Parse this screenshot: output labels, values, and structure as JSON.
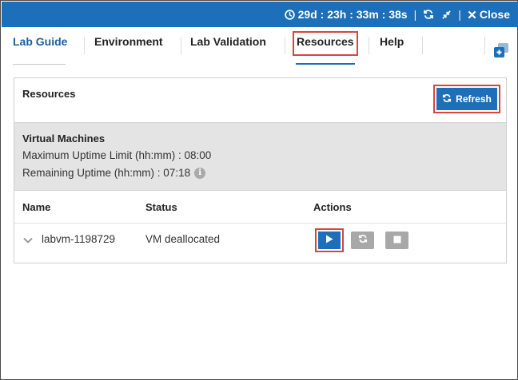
{
  "topbar": {
    "timer": "29d : 23h : 33m : 38s",
    "close_label": "Close",
    "icons": [
      "clock-icon",
      "refresh-icon",
      "shrink-icon",
      "close-icon"
    ]
  },
  "tabs": [
    {
      "label": "Lab Guide"
    },
    {
      "label": "Environment"
    },
    {
      "label": "Lab Validation"
    },
    {
      "label": "Resources"
    },
    {
      "label": "Help"
    }
  ],
  "panel": {
    "title": "Resources",
    "refresh_label": "Refresh"
  },
  "virtual_machines": {
    "title": "Virtual Machines",
    "max_uptime": "Maximum Uptime Limit (hh:mm) : 08:00",
    "remaining_uptime": "Remaining Uptime (hh:mm) : 07:18"
  },
  "table": {
    "headers": [
      "Name",
      "Status",
      "Actions"
    ],
    "rows": [
      {
        "name": "labvm-1198729",
        "status": "VM deallocated"
      }
    ]
  },
  "colors": {
    "accent": "#1c6fb8",
    "highlight": "#d9443f",
    "disabled": "#a8a8a8"
  }
}
